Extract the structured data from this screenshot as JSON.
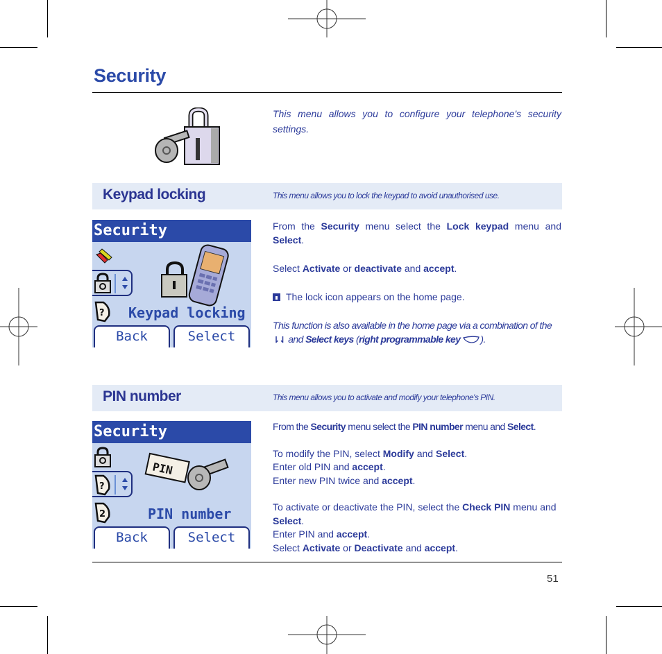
{
  "page": {
    "title": "Security",
    "intro": "This menu allows you to configure your telephone's security settings.",
    "page_number": "51"
  },
  "colors": {
    "title_blue": "#2b4aa8",
    "text_blue": "#2b3a9a",
    "band_bg": "#e4ebf6",
    "screen_bg": "#c7d6ef",
    "screen_header": "#2b4aa8"
  },
  "keypad_locking": {
    "heading": "Keypad locking",
    "description": "This menu allows you to lock the keypad to avoid unauthorised use.",
    "screen": {
      "header": "Security",
      "label": "Keypad locking",
      "left_softkey": "Back",
      "right_softkey": "Select",
      "icons": [
        "tools-icon",
        "padlock-icon",
        "help-icon"
      ],
      "illustration": "locked-phone-icon"
    },
    "steps": {
      "s1_a": "From the ",
      "s1_b": "Security",
      "s1_c": " menu select the ",
      "s1_d": "Lock keypad",
      "s1_e": " menu and ",
      "s1_f": "Select",
      "s1_g": ".",
      "s2_a": "Select ",
      "s2_b": "Activate",
      "s2_c": " or ",
      "s2_d": "deactivate",
      "s2_e": " and ",
      "s2_f": "accept",
      "s2_g": ".",
      "note": "The lock icon appears on the home page.",
      "tip_a": "This function is also available in the home page via a combination of the ",
      "tip_b": " and ",
      "tip_c": "Select keys",
      "tip_d": " (",
      "tip_e": "right programmable key",
      "tip_f": ")."
    }
  },
  "pin_number": {
    "heading": "PIN number",
    "description": "This menu allows you to activate and modify your telephone's PIN.",
    "screen": {
      "header": "Security",
      "label": "PIN number",
      "left_softkey": "Back",
      "right_softkey": "Select",
      "icons": [
        "padlock-icon",
        "help-icon",
        "help-2-icon"
      ],
      "illustration": "pin-key-icon",
      "tag_text": "PIN"
    },
    "steps": {
      "s1_a": "From the ",
      "s1_b": "Security",
      "s1_c": " menu select the ",
      "s1_d": "PIN number",
      "s1_e": " menu and ",
      "s1_f": "Select",
      "s1_g": ".",
      "m1_a": "To modify the PIN, select ",
      "m1_b": "Modify",
      "m1_c": " and ",
      "m1_d": "Select",
      "m1_e": ".",
      "m2_a": "Enter old PIN and ",
      "m2_b": "accept",
      "m2_c": ".",
      "m3_a": "Enter new PIN twice and ",
      "m3_b": "accept",
      "m3_c": ".",
      "c1_a": "To activate or deactivate the PIN, select the ",
      "c1_b": "Check PIN",
      "c1_c": " menu and ",
      "c1_d": "Select",
      "c1_e": ".",
      "c2_a": "Enter PIN and ",
      "c2_b": "accept",
      "c2_c": ".",
      "c3_a": "Select ",
      "c3_b": "Activate",
      "c3_c": " or ",
      "c3_d": "Deactivate",
      "c3_e": " and ",
      "c3_f": "accept",
      "c3_g": "."
    }
  }
}
